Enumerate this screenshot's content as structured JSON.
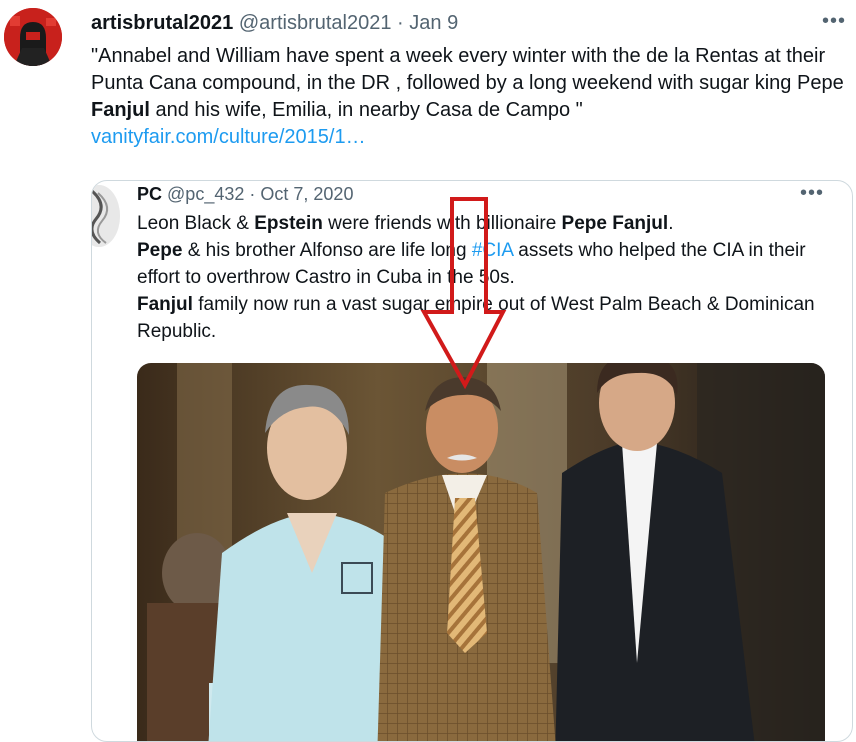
{
  "tweet": {
    "display_name": "artisbrutal2021",
    "handle": "@artisbrutal2021",
    "separator": "·",
    "date": "Jan 9",
    "more": "•••",
    "text_part1": "\"Annabel and William have spent a week every winter with the de la Rentas at their Punta Cana compound, in the DR , followed by a long weekend with sugar king Pepe ",
    "text_bold1": "Fanjul",
    "text_part2": " and his wife, Emilia, in nearby Casa de Campo \"",
    "link": "vanityfair.com/culture/2015/1…"
  },
  "quote": {
    "display_name": "PC",
    "handle": "@pc_432",
    "separator": "·",
    "date": "Oct 7, 2020",
    "more": "•••",
    "line1_a": "Leon Black & ",
    "line1_bold": "Epstein",
    "line1_b": " were friends with billionaire ",
    "line1_bold2": "Pepe Fanjul",
    "line1_c": ".",
    "line2_bold": "Pepe",
    "line2_a": " & his brother Alfonso are life long ",
    "line2_hashtag": "#CIA",
    "line2_b": " assets who helped the CIA in their effort to overthrow Castro in Cuba in the 50s.",
    "line3_bold": "Fanjul",
    "line3_a": " family now run a vast sugar empire out of West Palm Beach & Dominican Republic."
  },
  "colors": {
    "link": "#1d9bf0",
    "muted": "#536471",
    "arrow": "#d11a1a",
    "border": "#cfd9de"
  },
  "icons": [
    "more-icon",
    "avatar",
    "arrow-down-annotation"
  ]
}
